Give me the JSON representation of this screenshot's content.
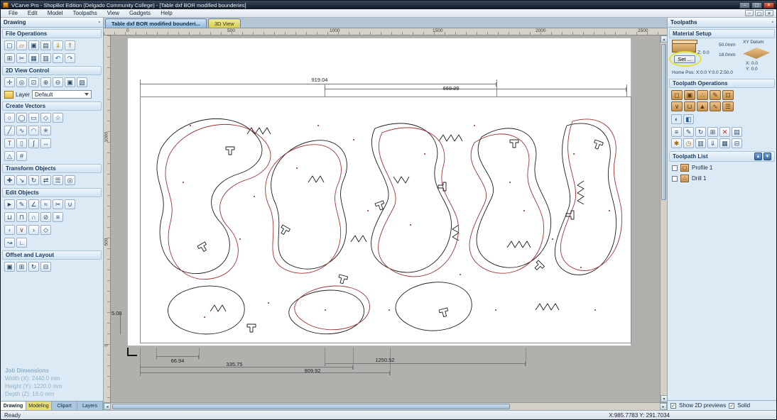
{
  "window": {
    "title": "VCarve Pro - ShopBot Edition (Delgado Community College) - [Table dxf BOR modified bounderies]",
    "menu": [
      "File",
      "Edit",
      "Model",
      "Toolpaths",
      "View",
      "Gadgets",
      "Help"
    ],
    "buttons": {
      "minimize": "–",
      "maximize": "▢",
      "close": "✕"
    }
  },
  "doc_tabs": {
    "tab1": "Table dxf BOR modified bounderi...",
    "tab2": "3D View"
  },
  "ruler": {
    "h": [
      "0",
      "500",
      "1000",
      "1500",
      "2000",
      "2500"
    ],
    "v": [
      "1000",
      "500",
      "0"
    ]
  },
  "dimensions": {
    "top1": "919.04",
    "top2": "668.29",
    "left": "5.08",
    "b1": "66.94",
    "b2": "335.75",
    "b3": "909.92",
    "b4": "1250.52"
  },
  "scroll": {
    "left": "◂",
    "right": "▸",
    "up": "▴",
    "down": "▾"
  },
  "drawing_panel": {
    "title": "Drawing",
    "pin": "▪",
    "file_operations": {
      "title": "File Operations",
      "row1": [
        {
          "name": "new-file-icon",
          "glyph": "▢"
        },
        {
          "name": "open-file-icon",
          "glyph": "▱",
          "color": "#9a7a1a"
        },
        {
          "name": "save-file-icon",
          "glyph": "▣"
        },
        {
          "name": "print-icon",
          "glyph": "▤"
        },
        {
          "name": "import-file-icon",
          "glyph": "⇓",
          "color": "#9a7a1a"
        },
        {
          "name": "export-file-icon",
          "glyph": "⇑",
          "color": "#9a7a1a"
        }
      ],
      "row2": [
        {
          "name": "snap-settings-icon",
          "glyph": "⊞"
        },
        {
          "name": "cut-icon",
          "glyph": "✂"
        },
        {
          "name": "copy-icon",
          "glyph": "▦"
        },
        {
          "name": "paste-icon",
          "glyph": "▥"
        },
        {
          "name": "undo-icon",
          "glyph": "↶",
          "color": "#2a6ab0"
        },
        {
          "name": "redo-icon",
          "glyph": "↷",
          "color": "#2a6ab0"
        }
      ]
    },
    "view_control": {
      "title": "2D View Control",
      "row1": [
        {
          "name": "pan-icon",
          "glyph": "✛"
        },
        {
          "name": "zoom-interactive-icon",
          "glyph": "◎"
        },
        {
          "name": "zoom-window-icon",
          "glyph": "⊡"
        },
        {
          "name": "zoom-in-icon",
          "glyph": "⊕"
        },
        {
          "name": "zoom-out-icon",
          "glyph": "⊖"
        },
        {
          "name": "zoom-extents-icon",
          "glyph": "▣"
        },
        {
          "name": "zoom-selected-icon",
          "glyph": "▧"
        }
      ]
    },
    "layer": {
      "label": "Layer",
      "value": "Default"
    },
    "create_vectors": {
      "title": "Create Vectors",
      "row1": [
        {
          "name": "circle-tool-icon",
          "glyph": "○"
        },
        {
          "name": "ellipse-tool-icon",
          "glyph": "◯"
        },
        {
          "name": "rectangle-tool-icon",
          "glyph": "▭"
        },
        {
          "name": "polygon-tool-icon",
          "glyph": "◇"
        },
        {
          "name": "star-tool-icon",
          "glyph": "☆"
        }
      ],
      "row2": [
        {
          "name": "draw-line-icon",
          "glyph": "╱"
        },
        {
          "name": "draw-curve-icon",
          "glyph": "∿"
        },
        {
          "name": "arc-tool-icon",
          "glyph": "◠"
        },
        {
          "name": "gear-shape-icon",
          "glyph": "✳"
        }
      ],
      "row3": [
        {
          "name": "text-tool-icon",
          "glyph": "T",
          "color": "#b03030"
        },
        {
          "name": "text-box-icon",
          "glyph": "▯",
          "color": "#2a6ab0"
        },
        {
          "name": "text-on-curve-icon",
          "glyph": "∫"
        },
        {
          "name": "dimension-tool-icon",
          "glyph": "↔"
        }
      ],
      "row4": [
        {
          "name": "vector-boundary-icon",
          "glyph": "△"
        },
        {
          "name": "snap-grid-tool-icon",
          "glyph": "#"
        }
      ]
    },
    "transform_objects": {
      "title": "Transform Objects",
      "row1": [
        {
          "name": "move-selection-icon",
          "glyph": "✚"
        },
        {
          "name": "set-size-icon",
          "glyph": "↘"
        },
        {
          "name": "rotate-icon",
          "glyph": "↻"
        },
        {
          "name": "mirror-icon",
          "glyph": "⇄"
        },
        {
          "name": "align-objects-icon",
          "glyph": "☰"
        },
        {
          "name": "center-in-material-icon",
          "glyph": "◎"
        }
      ]
    },
    "edit_objects": {
      "title": "Edit Objects",
      "row1": [
        {
          "name": "select-tool-icon",
          "glyph": "►"
        },
        {
          "name": "node-edit-icon",
          "glyph": "✎"
        },
        {
          "name": "measure-tool-icon",
          "glyph": "∠"
        },
        {
          "name": "offset-tool-icon",
          "glyph": "≈"
        },
        {
          "name": "trim-tool-icon",
          "glyph": "✂"
        },
        {
          "name": "join-vectors-icon",
          "glyph": "∪"
        }
      ],
      "row2": [
        {
          "name": "weld-vectors-icon",
          "glyph": "⊔"
        },
        {
          "name": "subtract-vectors-icon",
          "glyph": "⊓"
        },
        {
          "name": "intersect-vectors-icon",
          "glyph": "∩"
        },
        {
          "name": "slice-vectors-icon",
          "glyph": "⊘"
        },
        {
          "name": "flatten-vectors-icon",
          "glyph": "≡"
        }
      ],
      "row3": [
        {
          "name": "arrow-left-icon",
          "glyph": "‹"
        },
        {
          "name": "snap-vertex-icon",
          "glyph": "∨",
          "color": "#b03030"
        },
        {
          "name": "arrow-right-icon",
          "glyph": "›"
        },
        {
          "name": "close-vector-icon",
          "glyph": "◇"
        }
      ],
      "row4": [
        {
          "name": "extend-vector-icon",
          "glyph": "↝"
        },
        {
          "name": "fillet-tool-icon",
          "glyph": "∟"
        }
      ]
    },
    "offset_layout": {
      "title": "Offset and Layout",
      "row1": [
        {
          "name": "offset-vectors-icon",
          "glyph": "▣"
        },
        {
          "name": "array-copy-icon",
          "glyph": "⊞"
        },
        {
          "name": "rotate-copy-icon",
          "glyph": "↻"
        },
        {
          "name": "nesting-icon",
          "glyph": "⊟"
        }
      ]
    },
    "job_dimensions": {
      "title": "Job Dimensions",
      "width": "Width (X): 2440.0 mm",
      "height": "Height (Y): 1220.0 mm",
      "depth": "Depth (Z): 18.0 mm"
    },
    "tabs": [
      "Drawing",
      "Modeling",
      "Clipart",
      "Layers"
    ]
  },
  "toolpaths_panel": {
    "title": "Toolpaths",
    "pin": "▪",
    "material_setup": {
      "title": "Material Setup",
      "set_button": "Set ...",
      "z_label": "Z: 0.0",
      "thickness": "50.0mm",
      "below": "18.0mm",
      "xy_datum": "XY Datum",
      "x": "X: 0.0",
      "y": "Y: 0.0",
      "home_pos": "Home Pos:  X:0.0 Y:0.0 Z:50.0"
    },
    "operations": {
      "title": "Toolpath Operations",
      "grid1": [
        {
          "name": "profile-toolpath-icon",
          "glyph": "◻"
        },
        {
          "name": "pocket-toolpath-icon",
          "glyph": "▣"
        },
        {
          "name": "drilling-toolpath-icon",
          "glyph": "∴"
        },
        {
          "name": "quick-engrave-icon",
          "glyph": "✎"
        },
        {
          "name": "inlay-toolpath-icon",
          "glyph": "⊡"
        },
        {
          "name": "vcarve-toolpath-icon",
          "glyph": "∨"
        },
        {
          "name": "flat-bottom-carve-icon",
          "glyph": "⊔"
        },
        {
          "name": "prism-carve-icon",
          "glyph": "▲"
        },
        {
          "name": "moulding-toolpath-icon",
          "glyph": "∿"
        },
        {
          "name": "fluting-toolpath-icon",
          "glyph": "☰"
        }
      ],
      "grid2": [
        {
          "name": "preview-toolpaths-icon",
          "glyph": "◐",
          "bg": "#dcebf8",
          "color": "#2a5a8a"
        },
        {
          "name": "material-block-icon",
          "glyph": "◧",
          "bg": "#dcebf8",
          "color": "#2a5a8a"
        }
      ],
      "grid3": [
        {
          "name": "toolpath-summary-icon",
          "glyph": "≡"
        },
        {
          "name": "edit-toolpath-icon",
          "glyph": "✎"
        },
        {
          "name": "recalculate-toolpaths-icon",
          "glyph": "↻"
        },
        {
          "name": "merge-toolpaths-icon",
          "glyph": "⊞"
        },
        {
          "name": "delete-toolpath-icon",
          "glyph": "✕",
          "color": "#c02020"
        },
        {
          "name": "toolpath-template-icon",
          "glyph": "▤"
        },
        {
          "name": "tool-database-icon",
          "glyph": "✱",
          "color": "#9a6a1a"
        },
        {
          "name": "estimate-time-icon",
          "glyph": "◷",
          "color": "#b06a10"
        },
        {
          "name": "toolpath-tiling-icon",
          "glyph": "▥"
        },
        {
          "name": "save-toolpath-icon",
          "glyph": "⇓"
        },
        {
          "name": "copy-toolpath-icon",
          "glyph": "▦"
        },
        {
          "name": "material-grid-icon",
          "glyph": "⊟"
        }
      ]
    },
    "toolpath_list": {
      "title": "Toolpath List",
      "up": "▲",
      "down": "▼",
      "items": [
        {
          "glyph": "◻",
          "label": "Profile 1"
        },
        {
          "glyph": "∴",
          "label": "Drill 1"
        }
      ]
    },
    "footer": {
      "check_glyph": "✓",
      "show_2d": "Show 2D previews",
      "solid": "Solid"
    }
  },
  "status": {
    "ready": "Ready",
    "coords": "X:985.7783 Y: 291.7034"
  }
}
